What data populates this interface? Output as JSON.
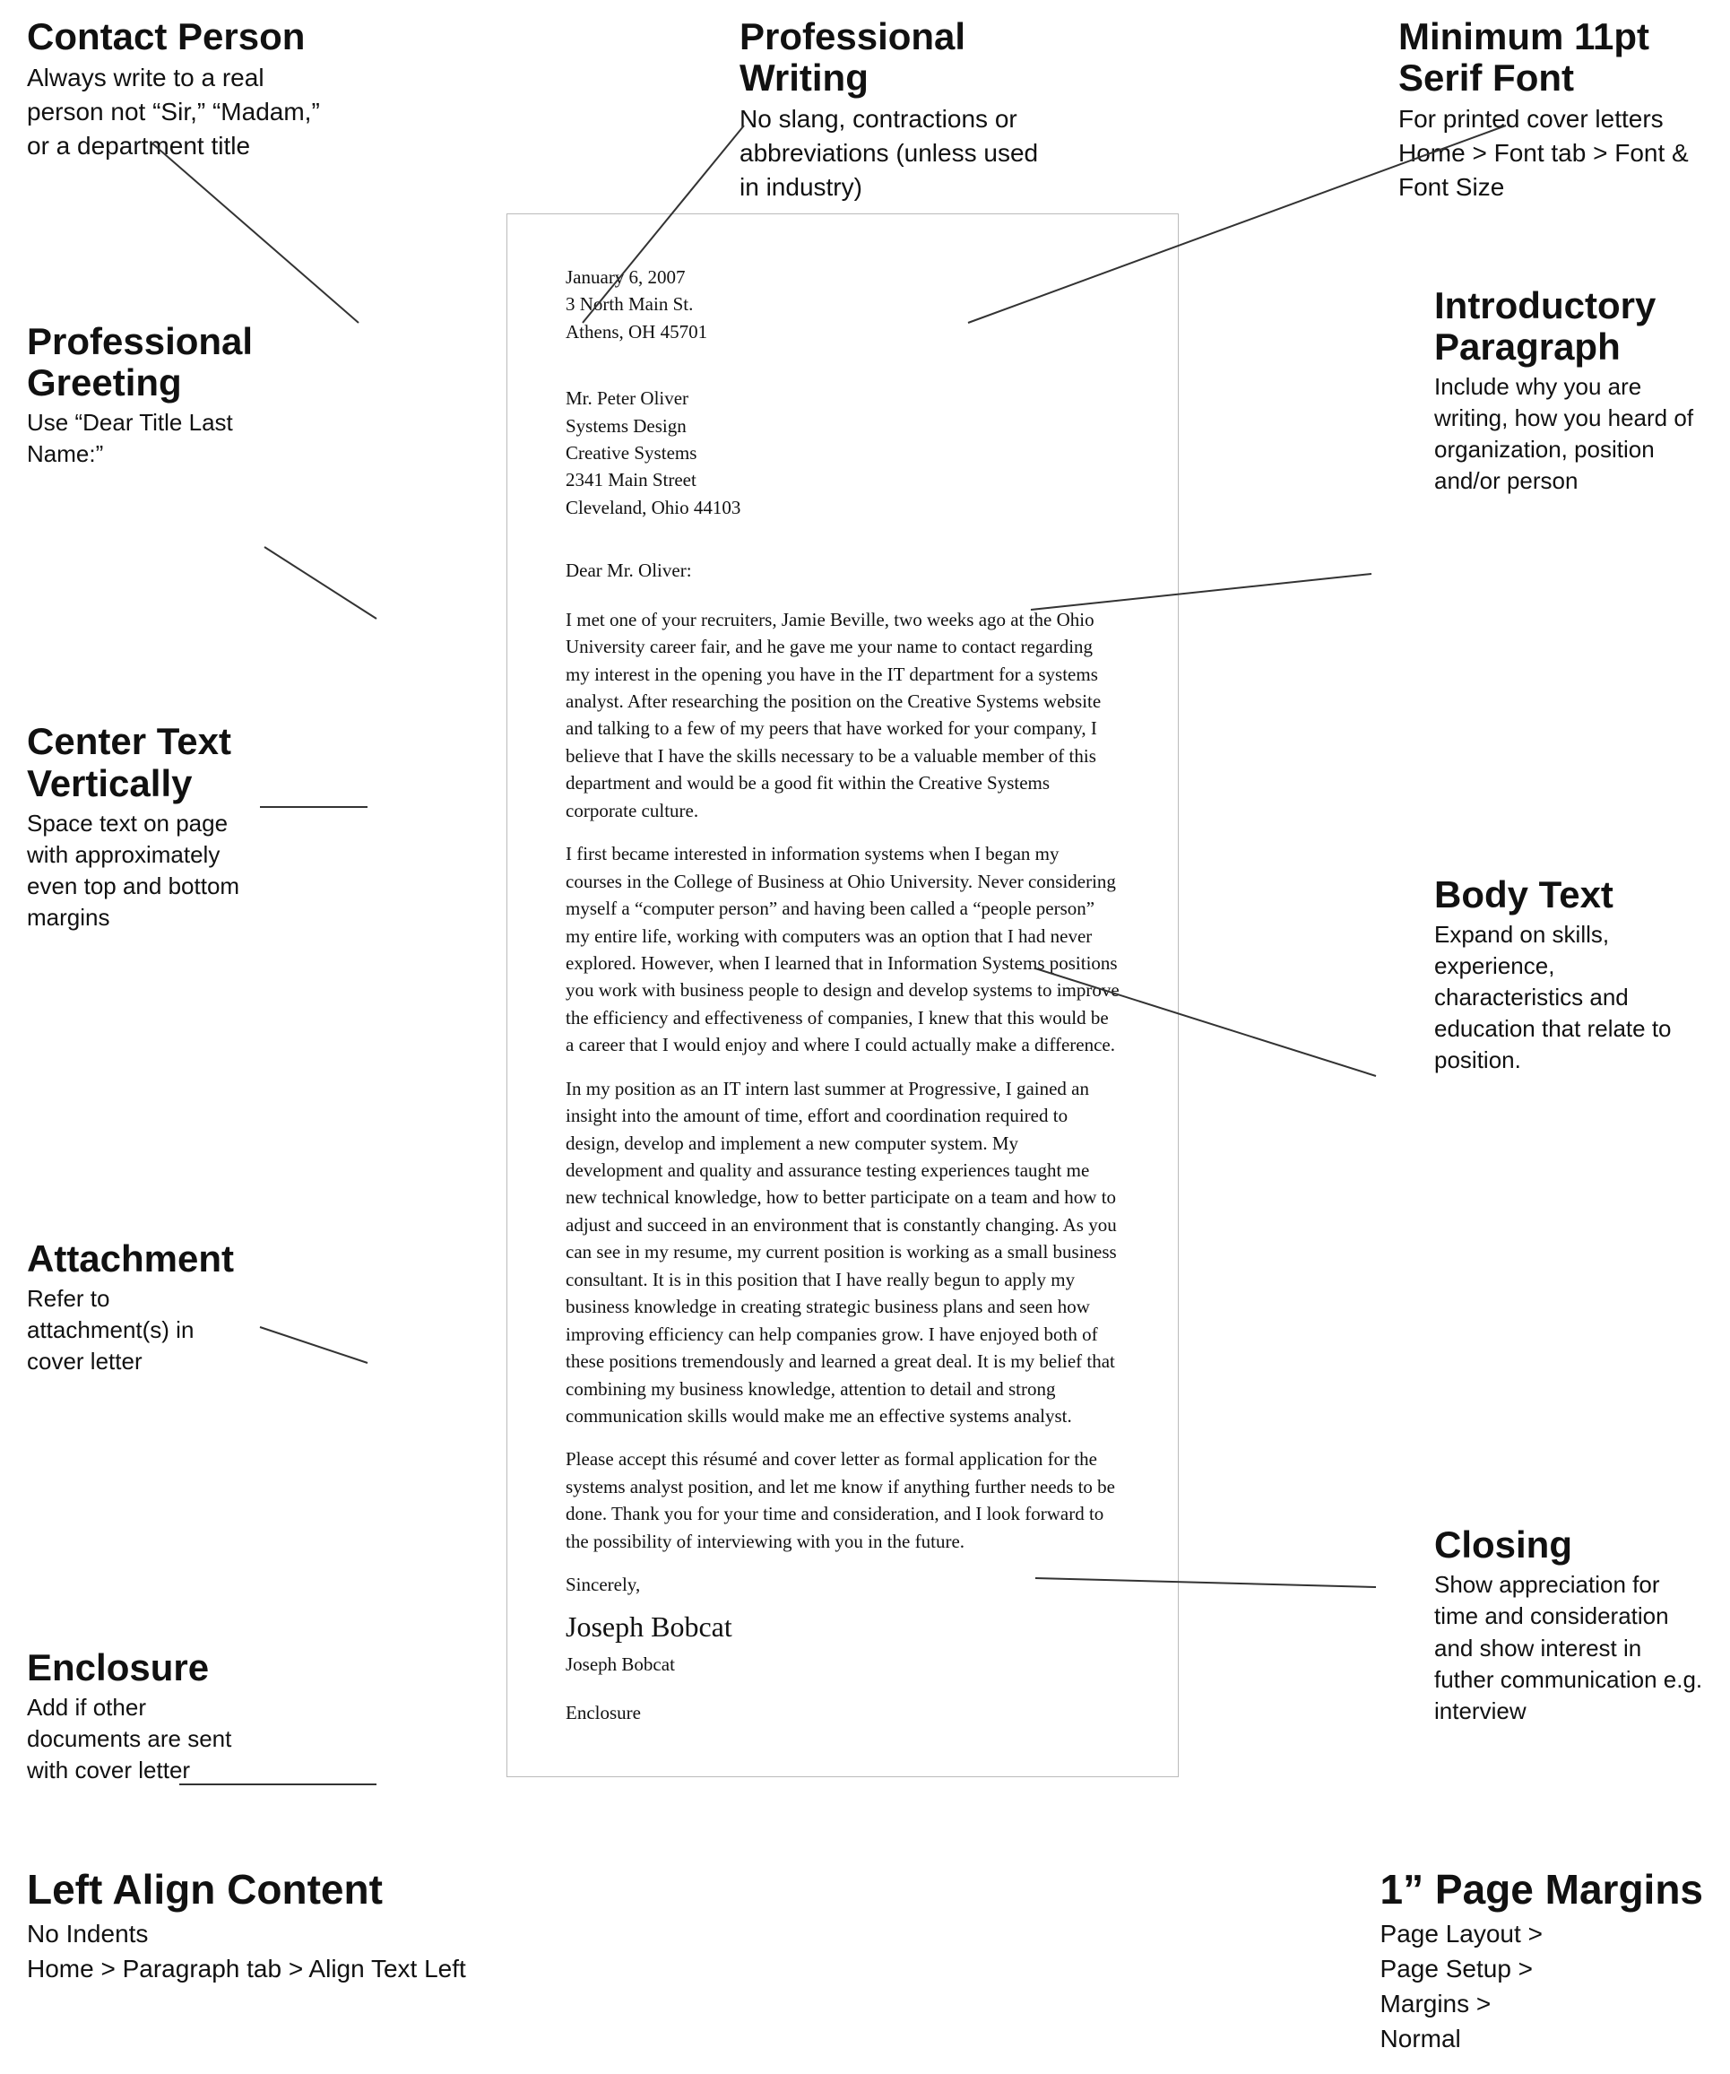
{
  "top_annotations": {
    "contact_person": {
      "title": "Contact Person",
      "body": "Always write to a real person not “Sir,” “Madam,” or a department title"
    },
    "professional_writing": {
      "title": "Professional Writing",
      "body": "No slang, contractions or abbreviations (unless used in industry)"
    },
    "minimum_font": {
      "title": "Minimum 11pt Serif Font",
      "body": "For printed cover letters\nHome > Font tab > Font & Font Size"
    }
  },
  "left_annotations": {
    "professional_greeting": {
      "title": "Professional Greeting",
      "body": "Use “Dear Title Last Name:”"
    },
    "center_text": {
      "title": "Center Text Vertically",
      "body": "Space text on page with approximately even top and bottom margins"
    },
    "attachment": {
      "title": "Attachment",
      "body": "Refer to attachment(s) in cover letter"
    },
    "enclosure": {
      "title": "Enclosure",
      "body": "Add if other documents are sent with cover letter"
    }
  },
  "right_annotations": {
    "introductory": {
      "title": "Introductory Paragraph",
      "body": "Include why you are writing, how you heard of organization, position and/or person"
    },
    "body_text": {
      "title": "Body Text",
      "body": "Expand on skills, experience, characteristics and education that relate to position."
    },
    "closing": {
      "title": "Closing",
      "body": "Show appreciation for time and consideration and show interest in futher communication e.g. interview"
    }
  },
  "bottom_annotations": {
    "left_align": {
      "title": "Left Align Content",
      "body": "No Indents\nHome > Paragraph tab > Align Text Left"
    },
    "page_margins": {
      "title": "1” Page Margins",
      "body": "Page Layout >\nPage Setup >\nMargins >\nNormal"
    }
  },
  "letter": {
    "sender_address": {
      "line1": "January 6, 2007",
      "line2": "3 North Main St.",
      "line3": "Athens, OH 45701"
    },
    "recipient": {
      "line1": "Mr. Peter Oliver",
      "line2": "Systems Design",
      "line3": "Creative Systems",
      "line4": "2341 Main Street",
      "line5": "Cleveland, Ohio  44103"
    },
    "salutation": "Dear Mr. Oliver:",
    "paragraphs": [
      "I met one of your recruiters, Jamie Beville, two weeks ago at the Ohio University career fair, and he gave me your name to contact regarding my interest in the opening you have in the IT department for a systems analyst. After researching the position on the Creative Systems website and talking to a few of my peers that have worked for your company, I believe that I have the skills necessary to be a valuable member of this department and would be a good fit within the Creative Systems corporate culture.",
      "I first became interested in information systems when I began my courses in the College of Business at Ohio University. Never considering myself a “computer person” and having been called a “people person” my entire life, working with computers was an option that I had never explored. However, when I learned that in Information Systems positions you work with business people to design and develop systems to improve the efficiency and effectiveness of companies, I knew that this would be a career that I would enjoy and where I could actually make a difference.",
      "In my position as an IT intern last summer at Progressive, I gained an insight into the amount of time, effort and coordination required to design, develop and implement a new computer system. My development and quality and assurance testing experiences taught me new technical knowledge, how to better participate on a team and how to adjust and succeed in an environment that is constantly changing. As you can see in my resume, my current position is working as a small business consultant. It is in this position that I have really begun to apply my business knowledge in creating strategic business plans and seen how improving efficiency can help companies grow. I have enjoyed both of these positions tremendously and learned a great deal. It is my belief that combining my business knowledge, attention to detail and strong communication skills would make me an effective systems analyst.",
      "Please accept this résumé and cover letter as formal application for the systems analyst position, and let me know if anything further needs to be done. Thank you for your time and consideration, and I look forward to the possibility of interviewing with you in the future."
    ],
    "closing": "Sincerely,",
    "signature_script": "Joseph Bobcat",
    "signature_typed": "Joseph Bobcat",
    "enclosure": "Enclosure"
  }
}
